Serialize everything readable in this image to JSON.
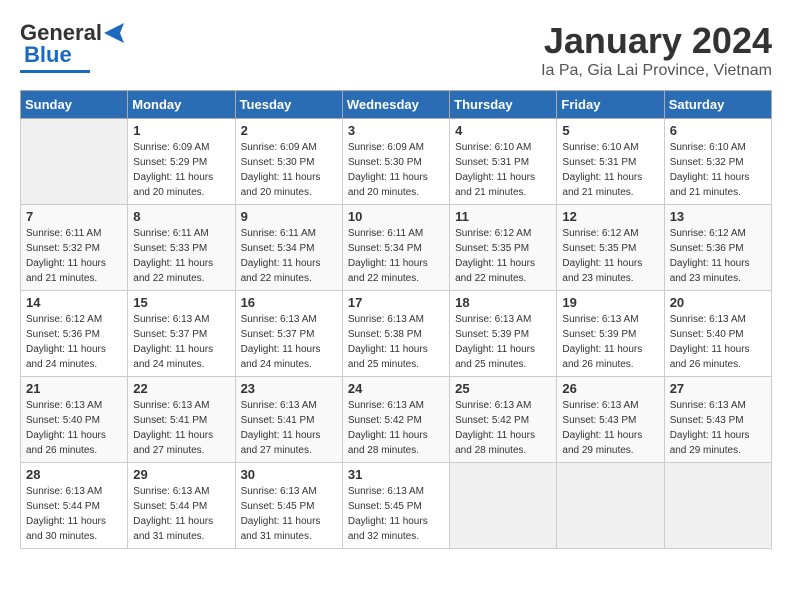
{
  "logo": {
    "line1": "General",
    "line2": "Blue"
  },
  "title": "January 2024",
  "subtitle": "Ia Pa, Gia Lai Province, Vietnam",
  "days_of_week": [
    "Sunday",
    "Monday",
    "Tuesday",
    "Wednesday",
    "Thursday",
    "Friday",
    "Saturday"
  ],
  "weeks": [
    [
      {
        "day": "",
        "sunrise": "",
        "sunset": "",
        "daylight": ""
      },
      {
        "day": "1",
        "sunrise": "Sunrise: 6:09 AM",
        "sunset": "Sunset: 5:29 PM",
        "daylight": "Daylight: 11 hours and 20 minutes."
      },
      {
        "day": "2",
        "sunrise": "Sunrise: 6:09 AM",
        "sunset": "Sunset: 5:30 PM",
        "daylight": "Daylight: 11 hours and 20 minutes."
      },
      {
        "day": "3",
        "sunrise": "Sunrise: 6:09 AM",
        "sunset": "Sunset: 5:30 PM",
        "daylight": "Daylight: 11 hours and 20 minutes."
      },
      {
        "day": "4",
        "sunrise": "Sunrise: 6:10 AM",
        "sunset": "Sunset: 5:31 PM",
        "daylight": "Daylight: 11 hours and 21 minutes."
      },
      {
        "day": "5",
        "sunrise": "Sunrise: 6:10 AM",
        "sunset": "Sunset: 5:31 PM",
        "daylight": "Daylight: 11 hours and 21 minutes."
      },
      {
        "day": "6",
        "sunrise": "Sunrise: 6:10 AM",
        "sunset": "Sunset: 5:32 PM",
        "daylight": "Daylight: 11 hours and 21 minutes."
      }
    ],
    [
      {
        "day": "7",
        "sunrise": "Sunrise: 6:11 AM",
        "sunset": "Sunset: 5:32 PM",
        "daylight": "Daylight: 11 hours and 21 minutes."
      },
      {
        "day": "8",
        "sunrise": "Sunrise: 6:11 AM",
        "sunset": "Sunset: 5:33 PM",
        "daylight": "Daylight: 11 hours and 22 minutes."
      },
      {
        "day": "9",
        "sunrise": "Sunrise: 6:11 AM",
        "sunset": "Sunset: 5:34 PM",
        "daylight": "Daylight: 11 hours and 22 minutes."
      },
      {
        "day": "10",
        "sunrise": "Sunrise: 6:11 AM",
        "sunset": "Sunset: 5:34 PM",
        "daylight": "Daylight: 11 hours and 22 minutes."
      },
      {
        "day": "11",
        "sunrise": "Sunrise: 6:12 AM",
        "sunset": "Sunset: 5:35 PM",
        "daylight": "Daylight: 11 hours and 22 minutes."
      },
      {
        "day": "12",
        "sunrise": "Sunrise: 6:12 AM",
        "sunset": "Sunset: 5:35 PM",
        "daylight": "Daylight: 11 hours and 23 minutes."
      },
      {
        "day": "13",
        "sunrise": "Sunrise: 6:12 AM",
        "sunset": "Sunset: 5:36 PM",
        "daylight": "Daylight: 11 hours and 23 minutes."
      }
    ],
    [
      {
        "day": "14",
        "sunrise": "Sunrise: 6:12 AM",
        "sunset": "Sunset: 5:36 PM",
        "daylight": "Daylight: 11 hours and 24 minutes."
      },
      {
        "day": "15",
        "sunrise": "Sunrise: 6:13 AM",
        "sunset": "Sunset: 5:37 PM",
        "daylight": "Daylight: 11 hours and 24 minutes."
      },
      {
        "day": "16",
        "sunrise": "Sunrise: 6:13 AM",
        "sunset": "Sunset: 5:37 PM",
        "daylight": "Daylight: 11 hours and 24 minutes."
      },
      {
        "day": "17",
        "sunrise": "Sunrise: 6:13 AM",
        "sunset": "Sunset: 5:38 PM",
        "daylight": "Daylight: 11 hours and 25 minutes."
      },
      {
        "day": "18",
        "sunrise": "Sunrise: 6:13 AM",
        "sunset": "Sunset: 5:39 PM",
        "daylight": "Daylight: 11 hours and 25 minutes."
      },
      {
        "day": "19",
        "sunrise": "Sunrise: 6:13 AM",
        "sunset": "Sunset: 5:39 PM",
        "daylight": "Daylight: 11 hours and 26 minutes."
      },
      {
        "day": "20",
        "sunrise": "Sunrise: 6:13 AM",
        "sunset": "Sunset: 5:40 PM",
        "daylight": "Daylight: 11 hours and 26 minutes."
      }
    ],
    [
      {
        "day": "21",
        "sunrise": "Sunrise: 6:13 AM",
        "sunset": "Sunset: 5:40 PM",
        "daylight": "Daylight: 11 hours and 26 minutes."
      },
      {
        "day": "22",
        "sunrise": "Sunrise: 6:13 AM",
        "sunset": "Sunset: 5:41 PM",
        "daylight": "Daylight: 11 hours and 27 minutes."
      },
      {
        "day": "23",
        "sunrise": "Sunrise: 6:13 AM",
        "sunset": "Sunset: 5:41 PM",
        "daylight": "Daylight: 11 hours and 27 minutes."
      },
      {
        "day": "24",
        "sunrise": "Sunrise: 6:13 AM",
        "sunset": "Sunset: 5:42 PM",
        "daylight": "Daylight: 11 hours and 28 minutes."
      },
      {
        "day": "25",
        "sunrise": "Sunrise: 6:13 AM",
        "sunset": "Sunset: 5:42 PM",
        "daylight": "Daylight: 11 hours and 28 minutes."
      },
      {
        "day": "26",
        "sunrise": "Sunrise: 6:13 AM",
        "sunset": "Sunset: 5:43 PM",
        "daylight": "Daylight: 11 hours and 29 minutes."
      },
      {
        "day": "27",
        "sunrise": "Sunrise: 6:13 AM",
        "sunset": "Sunset: 5:43 PM",
        "daylight": "Daylight: 11 hours and 29 minutes."
      }
    ],
    [
      {
        "day": "28",
        "sunrise": "Sunrise: 6:13 AM",
        "sunset": "Sunset: 5:44 PM",
        "daylight": "Daylight: 11 hours and 30 minutes."
      },
      {
        "day": "29",
        "sunrise": "Sunrise: 6:13 AM",
        "sunset": "Sunset: 5:44 PM",
        "daylight": "Daylight: 11 hours and 31 minutes."
      },
      {
        "day": "30",
        "sunrise": "Sunrise: 6:13 AM",
        "sunset": "Sunset: 5:45 PM",
        "daylight": "Daylight: 11 hours and 31 minutes."
      },
      {
        "day": "31",
        "sunrise": "Sunrise: 6:13 AM",
        "sunset": "Sunset: 5:45 PM",
        "daylight": "Daylight: 11 hours and 32 minutes."
      },
      {
        "day": "",
        "sunrise": "",
        "sunset": "",
        "daylight": ""
      },
      {
        "day": "",
        "sunrise": "",
        "sunset": "",
        "daylight": ""
      },
      {
        "day": "",
        "sunrise": "",
        "sunset": "",
        "daylight": ""
      }
    ]
  ]
}
